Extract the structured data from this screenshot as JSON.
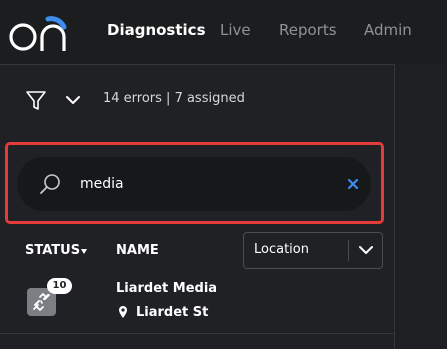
{
  "app": {
    "logo_text": "on"
  },
  "nav": {
    "items": [
      {
        "label": "Diagnostics",
        "active": true
      },
      {
        "label": "Live",
        "active": false
      },
      {
        "label": "Reports",
        "active": false
      },
      {
        "label": "Admin",
        "active": false
      }
    ]
  },
  "filter": {
    "icon": "filter-icon",
    "expand_icon": "chevron-down-icon",
    "summary": "14 errors | 7 assigned"
  },
  "search": {
    "icon": "search-icon",
    "value": "media",
    "clear_icon": "close-icon"
  },
  "table": {
    "columns": {
      "status": "STATUS",
      "name": "NAME"
    },
    "location_select": {
      "selected": "Location",
      "icon": "chevron-down-icon"
    },
    "rows": [
      {
        "status_icon": "broken-link-icon",
        "badge_count": "10",
        "name": "Liardet Media",
        "location_icon": "map-pin-icon",
        "location": "Liardet St"
      }
    ]
  },
  "colors": {
    "background": "#1f2124",
    "topbar": "#1b1d1f",
    "logo_accent": "#3d8ef0",
    "highlight": "#e53b3b",
    "clear_icon": "#3d8ef0",
    "status_icon_bg": "#7b7f84"
  }
}
